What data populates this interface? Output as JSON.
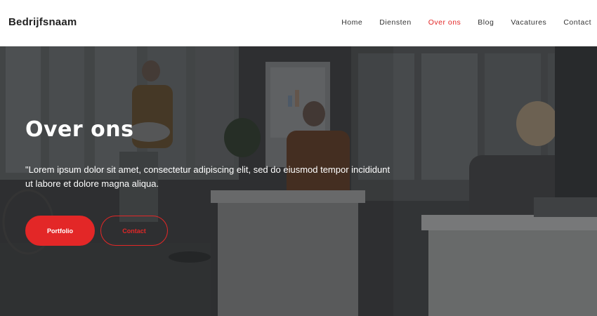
{
  "header": {
    "brand": "Bedrijfsnaam",
    "nav": [
      {
        "label": "Home",
        "active": false
      },
      {
        "label": "Diensten",
        "active": false
      },
      {
        "label": "Over ons",
        "active": true
      },
      {
        "label": "Blog",
        "active": false
      },
      {
        "label": "Vacatures",
        "active": false
      },
      {
        "label": "Contact",
        "active": false
      }
    ]
  },
  "hero": {
    "title": "Over ons",
    "text": "\"Lorem ipsum dolor sit amet, consectetur adipiscing elit, sed do eiusmod tempor incididunt ut labore et dolore magna aliqua.",
    "primary_button": "Portfolio",
    "secondary_button": "Contact"
  },
  "colors": {
    "accent": "#e32727",
    "header_bg": "#ffffff",
    "text_dark": "#222222"
  }
}
